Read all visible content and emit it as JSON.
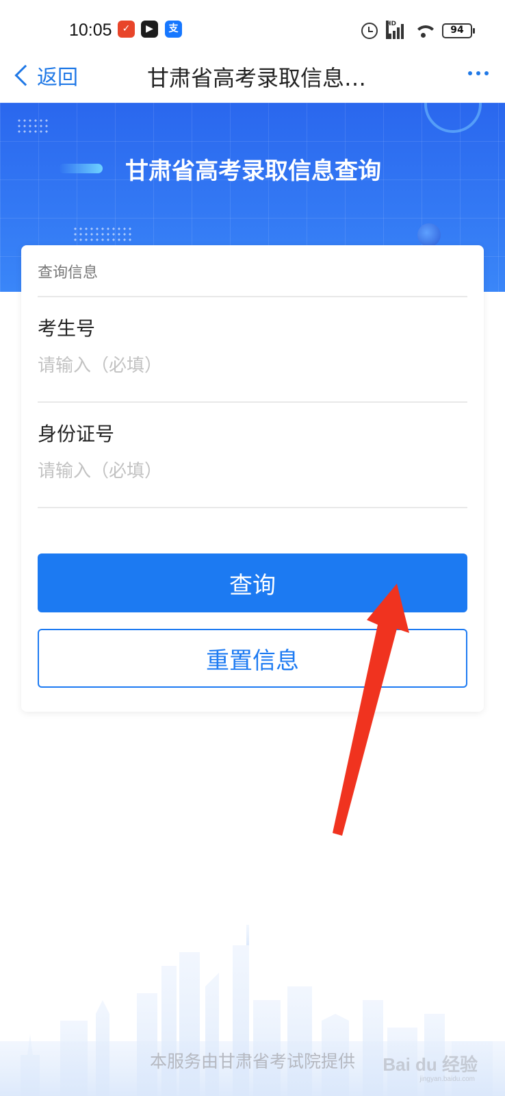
{
  "status_bar": {
    "time": "10:05",
    "app_icons": [
      "cn-app-icon",
      "video-app-icon",
      "alipay-icon"
    ],
    "battery_level": "94",
    "network_label": "HD"
  },
  "nav": {
    "back_label": "返回",
    "title": "甘肃省高考录取信息…"
  },
  "banner": {
    "title": "甘肃省高考录取信息查询"
  },
  "form": {
    "section_heading": "查询信息",
    "fields": [
      {
        "label": "考生号",
        "placeholder": "请输入（必填）",
        "value": ""
      },
      {
        "label": "身份证号",
        "placeholder": "请输入（必填）",
        "value": ""
      }
    ],
    "query_button": "查询",
    "reset_button": "重置信息"
  },
  "footer": {
    "text": "本服务由甘肃省考试院提供"
  },
  "watermark": {
    "brand": "Bai du 经验",
    "url": "jingyan.baidu.com"
  },
  "colors": {
    "accent": "#1c7af2",
    "banner": "#2c6ef0",
    "annotation_arrow": "#f0331f"
  }
}
